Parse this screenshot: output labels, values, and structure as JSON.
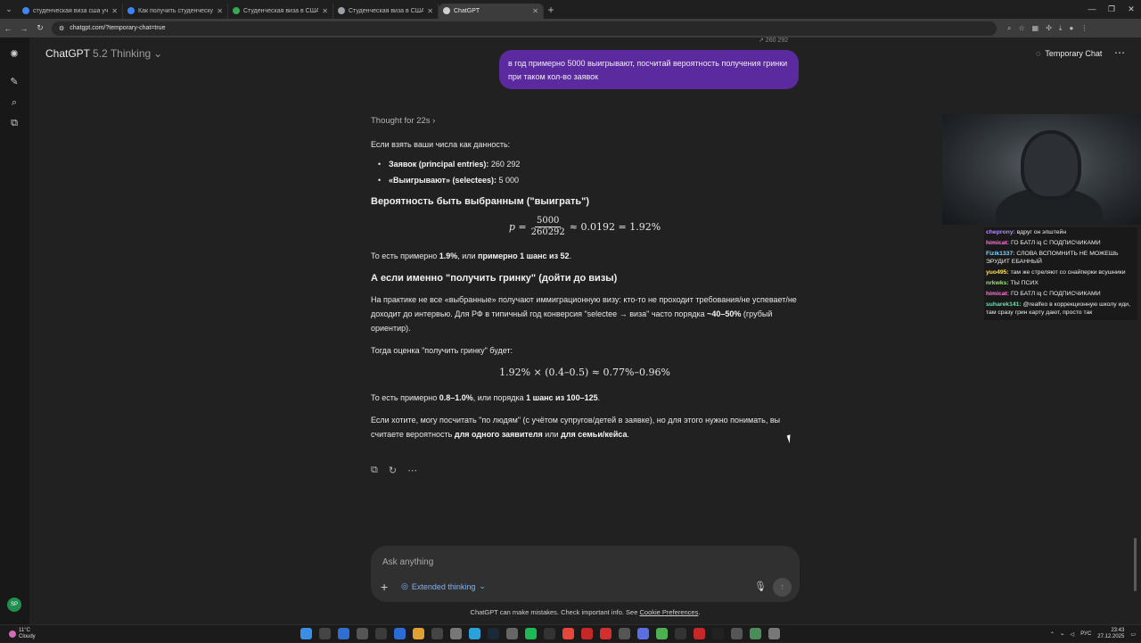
{
  "browser": {
    "tabs": [
      {
        "title": "студенческая виза сша учится",
        "color": "#4285f4"
      },
      {
        "title": "Как получить студенческую в",
        "color": "#3b82f6"
      },
      {
        "title": "Студенческая виза в США - ка",
        "color": "#34a853"
      },
      {
        "title": "Студенческая виза в США: сле",
        "color": "#9aa0a6"
      },
      {
        "title": "ChatGPT",
        "color": "#cfcfcf"
      }
    ],
    "url": "chatgpt.com/?temporary-chat=true"
  },
  "header": {
    "model_name": "ChatGPT",
    "model_version": "5.2 Thinking",
    "temporary_chat": "Temporary Chat"
  },
  "conversation": {
    "cutoff_text": "↗ 260 292",
    "user_message": "в год примерно 5000 выигрывают, посчитай вероятность получения гринки при таком кол-во заявок",
    "thought": "Thought for 22s",
    "intro": "Если взять ваши числа как данность:",
    "bullets": [
      {
        "label": "Заявок (principal entries):",
        "value": "260 292"
      },
      {
        "label": "«Выигрывают» (selectees):",
        "value": "5 000"
      }
    ],
    "h1": "Вероятность быть выбранным (\"выиграть\")",
    "formula1": {
      "lhs": "p =",
      "num": "5000",
      "den": "260292",
      "rhs": "≈ 0.0192 = 1.92%"
    },
    "p1": {
      "t1": "То есть примерно ",
      "b1": "1.9%",
      "t2": ", или ",
      "b2": "примерно 1 шанс из 52",
      "t3": "."
    },
    "h2": "А если именно \"получить гринку\" (дойти до визы)",
    "p2": {
      "t1": "На практике не все «выбранные» получают иммиграционную визу: кто-то не проходит требования/не успевает/не доходит до интервью. Для РФ в типичный год конверсия \"selectee → виза\" часто порядка ",
      "b1": "~40–50%",
      "t2": " (грубый ориентир)."
    },
    "p3": "Тогда оценка \"получить гринку\" будет:",
    "formula2": "1.92% × (0.4–0.5) ≈ 0.77%–0.96%",
    "p4": {
      "t1": "То есть примерно ",
      "b1": "0.8–1.0%",
      "t2": ", или порядка ",
      "b2": "1 шанс из 100–125",
      "t3": "."
    },
    "p5": {
      "t1": "Если хотите, могу посчитать \"по людям\" (с учётом супругов/детей в заявке), но для этого нужно понимать, вы считаете вероятность ",
      "b1": "для одного заявителя",
      "t2": " или ",
      "b2": "для семьи/кейса",
      "t3": "."
    }
  },
  "composer": {
    "placeholder": "Ask anything",
    "mode": "Extended thinking"
  },
  "disclaimer": {
    "text": "ChatGPT can make mistakes. Check important info. See ",
    "link": "Cookie Preferences",
    "end": "."
  },
  "stream_chat": [
    {
      "nick": "cheprony:",
      "color": "#b48cff",
      "text": "вдруг он эпштейн"
    },
    {
      "nick": "himicat:",
      "color": "#ff7ad9",
      "text": "ГО БАТЛ iq С ПОДПИСЧИКАМИ"
    },
    {
      "nick": "Fizik1337:",
      "color": "#7fd4ff",
      "text": "СЛОВА ВСПОМНИТЬ НЕ МОЖЕШЬ ЭРУДИТ ЕБАННЫЙ"
    },
    {
      "nick": "yuo495:",
      "color": "#ffe066",
      "text": "там же стреляют со снайперки всушники"
    },
    {
      "nick": "nrkwks:",
      "color": "#9be37a",
      "text": "ТЫ ПСИХ"
    },
    {
      "nick": "himicat:",
      "color": "#ff7ad9",
      "text": "ГО БАТЛ iq С ПОДПИСЧИКАМИ"
    },
    {
      "nick": "suharek141:",
      "color": "#6fe0b0",
      "text": "@realfeo в коррекционную школу иди, там сразу грин карту дают, просто так"
    }
  ],
  "taskbar": {
    "temp": "11°C",
    "weather": "Cloudy",
    "lang": "РУС",
    "time": "23:43",
    "date": "27.12.2025"
  }
}
